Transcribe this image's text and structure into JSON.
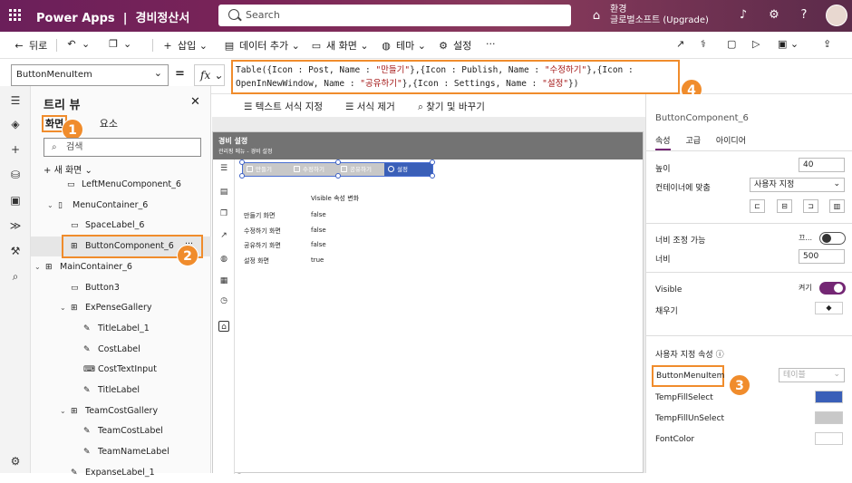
{
  "header": {
    "brand": "Power Apps",
    "app_name": "경비정산서",
    "search_placeholder": "Search",
    "env_label": "환경",
    "env_name": "글로벌소프트 (Upgrade)"
  },
  "commands": {
    "back": "뒤로",
    "insert": "삽입",
    "add_data": "데이터 추가",
    "new_screen": "새 화면",
    "theme": "테마",
    "settings": "설정",
    "more": "···"
  },
  "formula_bar": {
    "property": "ButtonMenuItem",
    "equals": "=",
    "fx": "fx",
    "line1_a": "Table({Icon : Post, Name : ",
    "line1_s1": "\"만들기\"",
    "line1_b": "},{Icon : Publish, Name : ",
    "line1_s2": "\"수정하기\"",
    "line1_c": "},{Icon :",
    "line2_a": "OpenInNewWindow, Name : ",
    "line2_s1": "\"공유하기\"",
    "line2_b": "},{Icon : Settings, Name : ",
    "line2_s2": "\"설정\"",
    "line2_c": "})",
    "format_text": "텍스트 서식 지정",
    "remove_format": "서식 제거",
    "find_replace": "찾기 및 바꾸기"
  },
  "tree": {
    "title": "트리 뷰",
    "tab_screens": "화면",
    "tab_components": "요소",
    "search_placeholder": "검색",
    "new_screen": "새 화면",
    "nodes": [
      {
        "label": "LeftMenuComponent_6",
        "indent": 40,
        "twisty": ""
      },
      {
        "label": "MenuContainer_6",
        "indent": 30,
        "twisty": "⌄"
      },
      {
        "label": "SpaceLabel_6",
        "indent": 44,
        "twisty": ""
      },
      {
        "label": "ButtonComponent_6",
        "indent": 44,
        "twisty": ""
      },
      {
        "label": "MainContainer_6",
        "indent": 16,
        "twisty": "⌄"
      },
      {
        "label": "Button3",
        "indent": 44,
        "twisty": ""
      },
      {
        "label": "ExPenseGallery",
        "indent": 44,
        "twisty": "⌄"
      },
      {
        "label": "TitleLabel_1",
        "indent": 58,
        "twisty": ""
      },
      {
        "label": "CostLabel",
        "indent": 58,
        "twisty": ""
      },
      {
        "label": "CostTextInput",
        "indent": 58,
        "twisty": ""
      },
      {
        "label": "TitleLabel",
        "indent": 58,
        "twisty": ""
      },
      {
        "label": "TeamCostGallery",
        "indent": 44,
        "twisty": "⌄"
      },
      {
        "label": "TeamCostLabel",
        "indent": 58,
        "twisty": ""
      },
      {
        "label": "TeamNameLabel",
        "indent": 58,
        "twisty": ""
      },
      {
        "label": "ExpanseLabel_1",
        "indent": 44,
        "twisty": ""
      }
    ],
    "more": "···"
  },
  "canvas": {
    "header_title": "경비 설정",
    "header_sub": "관리핑 메뉴 - 경비 설정",
    "menu_items": [
      "만들기",
      "수정하기",
      "공유하기",
      "설정"
    ],
    "visible_header": "Visible 속성 변화",
    "rows": [
      {
        "label": "만들기 화면",
        "value": "false"
      },
      {
        "label": "수정하기 화면",
        "value": "false"
      },
      {
        "label": "공유하기 화면",
        "value": "false"
      },
      {
        "label": "설정 화면",
        "value": "true"
      }
    ]
  },
  "properties": {
    "component": "ButtonComponent_6",
    "tab_props": "속성",
    "tab_advanced": "고급",
    "tab_ideas": "아이디어",
    "height_label": "높이",
    "height_value": "40",
    "fit_label": "컨테이너에 맞춤",
    "fit_value": "사용자 지정",
    "resize_label": "너비 조정 가능",
    "resize_state": "끄...",
    "width_label": "너비",
    "width_value": "500",
    "visible_label": "Visible",
    "visible_state": "켜기",
    "fill_label": "채우기",
    "custom_label": "사용자 지정 속성",
    "menu_item_label": "ButtonMenuItem",
    "menu_item_value": "테이블",
    "fill_select_label": "TempFillSelect",
    "fill_unselect_label": "TempFillUnSelect",
    "font_color_label": "FontColor"
  },
  "badges": [
    "1",
    "2",
    "3",
    "4"
  ],
  "colors": {
    "accent": "#742774",
    "highlight": "#f08c2c",
    "fill_select": "#3a5fb8",
    "fill_unselect": "#c8c8c8",
    "font_color": "#ffffff"
  }
}
